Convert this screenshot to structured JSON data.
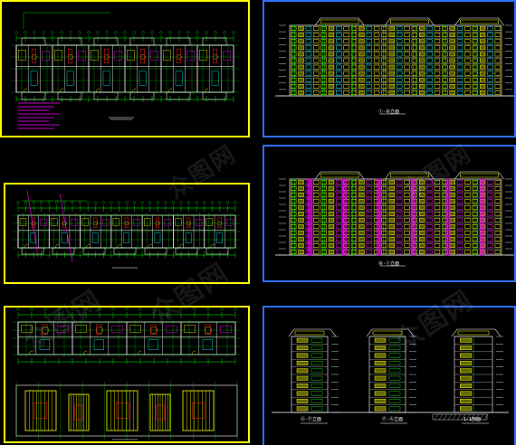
{
  "viewer": {
    "background": "#000000",
    "colors": {
      "frame_yellow": "#ffff00",
      "frame_blue": "#2f6fff",
      "line_green": "#00ff00",
      "line_yellow": "#ffff00",
      "line_red": "#ff2020",
      "line_magenta": "#ff00ff",
      "line_cyan": "#00ffff",
      "line_white": "#ffffff"
    }
  },
  "sheets": [
    {
      "id": "plan-1",
      "kind": "floor-plan",
      "frame_color": "yellow",
      "caption": ""
    },
    {
      "id": "plan-2",
      "kind": "floor-plan",
      "frame_color": "yellow",
      "caption": ""
    },
    {
      "id": "plan-3",
      "kind": "floor-plan-stacked",
      "frame_color": "yellow",
      "caption": ""
    },
    {
      "id": "elev-1",
      "kind": "front-elevation",
      "frame_color": "blue",
      "caption": "①-⑩立面"
    },
    {
      "id": "elev-2",
      "kind": "rear-elevation",
      "frame_color": "blue",
      "caption": "⑩-①立面"
    },
    {
      "id": "elev-3",
      "kind": "side-elevations",
      "frame_color": "blue",
      "caption": ""
    }
  ],
  "side_captions": [
    "Ⓐ-Ⓕ立面",
    "Ⓕ-Ⓐ立面",
    "1-1剖面"
  ],
  "watermark": "众图网"
}
